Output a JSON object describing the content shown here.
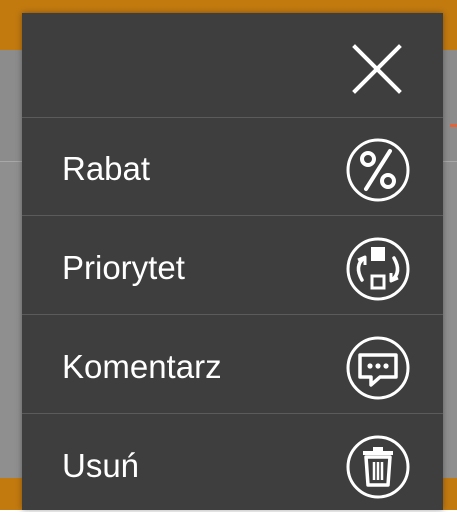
{
  "menu": {
    "close_icon": "close-icon",
    "items": [
      {
        "label": "Rabat",
        "icon": "percent-icon"
      },
      {
        "label": "Priorytet",
        "icon": "priority-swap-icon"
      },
      {
        "label": "Komentarz",
        "icon": "comment-icon"
      },
      {
        "label": "Usuń",
        "icon": "trash-icon"
      }
    ]
  },
  "colors": {
    "menu_background": "#3e3e3e",
    "divider": "#5b5b5b",
    "text": "#ffffff",
    "backdrop": "#8f8f8f",
    "accent_orange": "#c27a0f"
  }
}
